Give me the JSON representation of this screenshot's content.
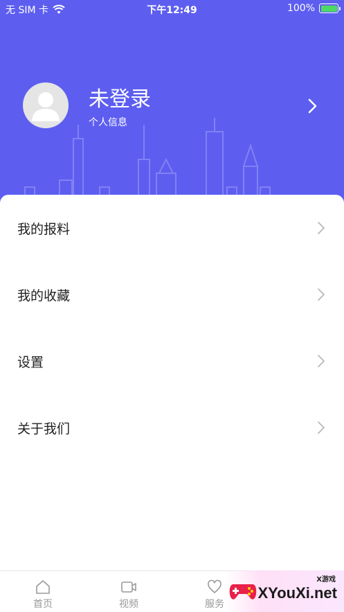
{
  "status_bar": {
    "carrier": "无 SIM 卡",
    "time": "下午12:49",
    "battery": "100%"
  },
  "profile": {
    "name": "未登录",
    "subtitle": "个人信息"
  },
  "menu": {
    "items": [
      {
        "label": "我的报料"
      },
      {
        "label": "我的收藏"
      },
      {
        "label": "设置"
      },
      {
        "label": "关于我们"
      }
    ]
  },
  "tabbar": {
    "tabs": [
      {
        "label": "首页",
        "icon": "home-icon"
      },
      {
        "label": "视频",
        "icon": "video-icon"
      },
      {
        "label": "服务",
        "icon": "heart-icon"
      }
    ]
  },
  "watermark": {
    "small_text": "X游戏",
    "big_text": "XYouXi.net"
  },
  "colors": {
    "header": "#5d5ef0",
    "battery": "#4cd964",
    "text_primary": "#222222",
    "tab_inactive": "#999999"
  }
}
